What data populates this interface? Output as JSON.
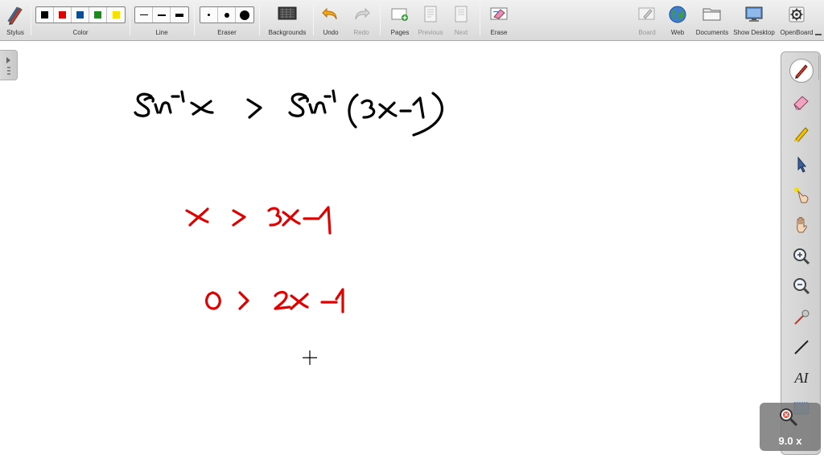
{
  "toolbar": {
    "stylus": "Stylus",
    "color": "Color",
    "line": "Line",
    "eraser": "Eraser",
    "backgrounds": "Backgrounds",
    "undo": "Undo",
    "redo": "Redo",
    "pages": "Pages",
    "previous": "Previous",
    "next": "Next",
    "erase": "Erase",
    "board": "Board",
    "web": "Web",
    "documents": "Documents",
    "show_desktop": "Show Desktop",
    "openboard": "OpenBoard"
  },
  "colors": {
    "swatches": [
      "#000000",
      "#e00000",
      "#0a4f9a",
      "#1a8a1a",
      "#f5e000"
    ],
    "ink_black": "#000000",
    "ink_red": "#e00000"
  },
  "palette": {
    "tools": [
      "pen-icon",
      "eraser-icon",
      "highlighter-icon",
      "selector-icon",
      "laser-pointer-icon",
      "hand-icon",
      "zoom-in-icon",
      "zoom-out-icon",
      "capture-pointer-icon",
      "line-icon",
      "text-icon",
      "capture-icon"
    ],
    "text_tool": "AI"
  },
  "zoom": {
    "level": "9.0 x"
  }
}
